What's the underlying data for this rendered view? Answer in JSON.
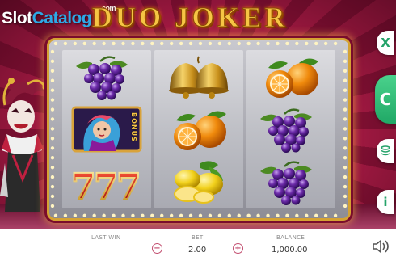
{
  "watermark": {
    "part1": "Slot",
    "part2": "Catalog",
    "suffix": ".com"
  },
  "game": {
    "title": "DUO JOKER"
  },
  "reels": [
    {
      "symbols": [
        "grapes-icon",
        "scatter-bonus-icon",
        "seven-icon"
      ]
    },
    {
      "symbols": [
        "bells-icon",
        "oranges-icon",
        "lemons-icon"
      ]
    },
    {
      "symbols": [
        "oranges-icon",
        "grapes-icon",
        "grapes-icon"
      ]
    }
  ],
  "bonus_symbol": {
    "text": "BONUS"
  },
  "side_buttons": {
    "close": "X",
    "spin": "C",
    "stack": "coins-icon",
    "info": "i"
  },
  "bottom": {
    "last_win_label": "LAST WIN",
    "last_win_value": "",
    "bet_label": "BET",
    "bet_value": "2.00",
    "minus": "−",
    "plus": "+",
    "balance_label": "BALANCE",
    "balance_value": "1,000.00"
  },
  "colors": {
    "accent_green": "#25a36a",
    "accent_pink": "#c24d6f",
    "gold": "#f6c544",
    "background_red": "#b51d4a"
  }
}
